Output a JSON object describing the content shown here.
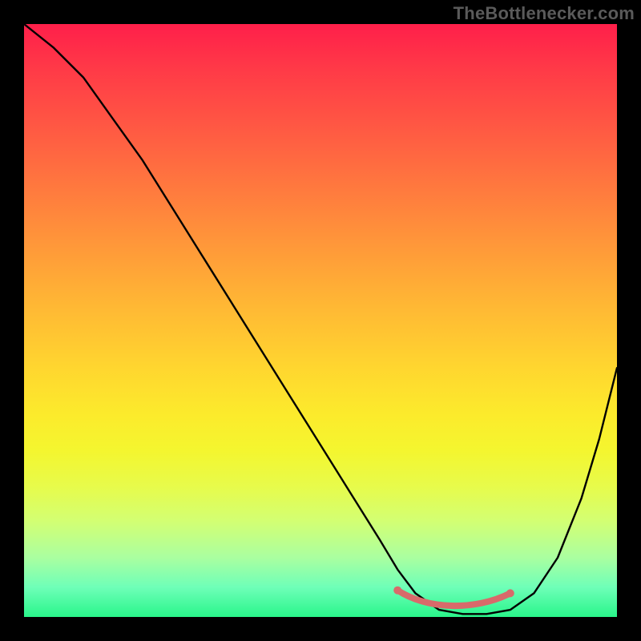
{
  "watermark": "TheBottleneсker.com",
  "chart_data": {
    "type": "line",
    "title": "",
    "xlabel": "",
    "ylabel": "",
    "xlim": [
      0,
      100
    ],
    "ylim": [
      0,
      100
    ],
    "grid": false,
    "series": [
      {
        "name": "bottleneck-curve",
        "color": "#000000",
        "x": [
          0,
          5,
          10,
          15,
          20,
          25,
          30,
          35,
          40,
          45,
          50,
          55,
          60,
          63,
          66,
          70,
          74,
          78,
          82,
          86,
          90,
          94,
          97,
          100
        ],
        "y": [
          100,
          96,
          91,
          84,
          77,
          69,
          61,
          53,
          45,
          37,
          29,
          21,
          13,
          8,
          4,
          1.2,
          0.5,
          0.5,
          1.2,
          4,
          10,
          20,
          30,
          42
        ]
      }
    ],
    "markers": [
      {
        "name": "bottleneck-start",
        "x": 63,
        "y": 4.5,
        "color": "#d86a6a",
        "r": 5
      },
      {
        "name": "bottleneck-end",
        "x": 82,
        "y": 4.0,
        "color": "#d86a6a",
        "r": 5
      }
    ],
    "bottleneck_band": {
      "color": "#d86a6a",
      "width": 8,
      "x0": 63,
      "y0": 4.5,
      "x1": 68,
      "y1": 1.2,
      "x2": 76,
      "y2": 1.0,
      "x3": 82,
      "y3": 4.0
    },
    "gradient_stops": [
      {
        "pos": 0,
        "color": "#ff1f4a"
      },
      {
        "pos": 8,
        "color": "#ff3b47"
      },
      {
        "pos": 18,
        "color": "#ff5a43"
      },
      {
        "pos": 28,
        "color": "#ff7a3e"
      },
      {
        "pos": 38,
        "color": "#ff9a39"
      },
      {
        "pos": 48,
        "color": "#ffb934"
      },
      {
        "pos": 58,
        "color": "#ffd62f"
      },
      {
        "pos": 66,
        "color": "#fceb2c"
      },
      {
        "pos": 72,
        "color": "#f4f62f"
      },
      {
        "pos": 78,
        "color": "#e7fb4b"
      },
      {
        "pos": 84,
        "color": "#d2ff74"
      },
      {
        "pos": 90,
        "color": "#aaffa0"
      },
      {
        "pos": 95,
        "color": "#6effb8"
      },
      {
        "pos": 100,
        "color": "#29f58a"
      }
    ]
  }
}
